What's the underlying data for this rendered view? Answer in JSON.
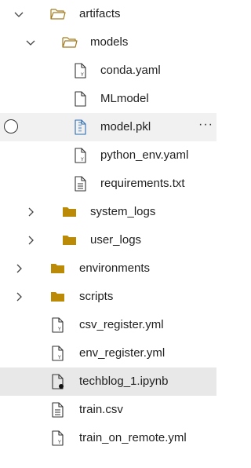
{
  "tree": {
    "items": [
      {
        "label": "artifacts",
        "icon": "folder-open-outline-icon"
      },
      {
        "label": "models",
        "icon": "folder-open-outline-icon"
      },
      {
        "label": "conda.yaml",
        "icon": "yaml-file-icon"
      },
      {
        "label": "MLmodel",
        "icon": "file-icon"
      },
      {
        "label": "model.pkl",
        "icon": "binary-file-icon"
      },
      {
        "label": "python_env.yaml",
        "icon": "yaml-file-icon"
      },
      {
        "label": "requirements.txt",
        "icon": "text-file-icon"
      },
      {
        "label": "system_logs",
        "icon": "folder-icon"
      },
      {
        "label": "user_logs",
        "icon": "folder-icon"
      },
      {
        "label": "environments",
        "icon": "folder-icon"
      },
      {
        "label": "scripts",
        "icon": "folder-icon"
      },
      {
        "label": "csv_register.yml",
        "icon": "yaml-file-icon"
      },
      {
        "label": "env_register.yml",
        "icon": "yaml-file-icon"
      },
      {
        "label": "techblog_1.ipynb",
        "icon": "notebook-file-icon"
      },
      {
        "label": "train.csv",
        "icon": "text-file-icon"
      },
      {
        "label": "train_on_remote.yml",
        "icon": "yaml-file-icon"
      }
    ],
    "more_actions": "···"
  },
  "colors": {
    "folder": "#bb8a06",
    "folder_outline": "#a27a1e",
    "binary_icon": "#2b6cb0",
    "selected_row": "#f1f1f1",
    "active_row": "#e8e8e8"
  }
}
